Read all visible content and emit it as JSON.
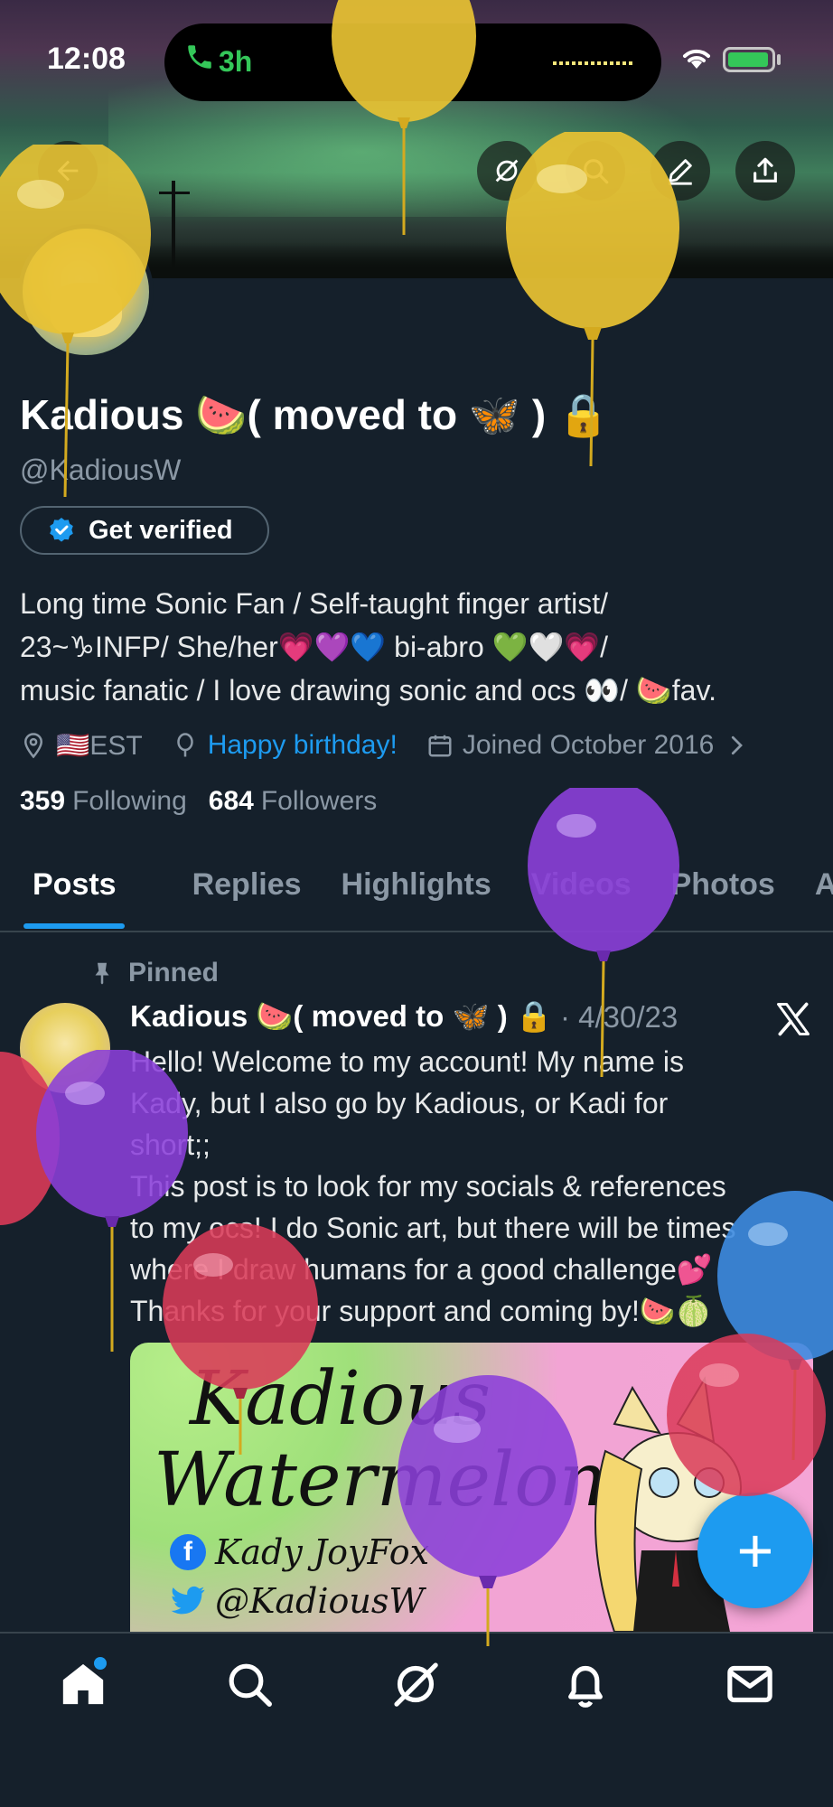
{
  "status_bar": {
    "time": "12:08",
    "call_duration": "3h"
  },
  "banner": {
    "back_icon": "back-arrow-icon",
    "actions": [
      "grok-icon",
      "search-icon",
      "edit-icon",
      "share-icon"
    ]
  },
  "profile": {
    "display_name": "Kadious 🍉( moved to 🦋 ) 🔒",
    "handle": "@KadiousW",
    "verify_label": "Get verified",
    "bio_lines": [
      "Long time Sonic Fan / Self-taught finger artist/",
      "23~♑INFP/ She/her💗💜💙 bi-abro 💚🤍💗/",
      "music fanatic / I love drawing sonic and ocs 👀/ 🍉fav."
    ],
    "location": "🇺🇸EST",
    "birthday": "Happy birthday!",
    "joined": "Joined October 2016",
    "following_count": "359",
    "following_label": "Following",
    "followers_count": "684",
    "followers_label": "Followers"
  },
  "tabs": [
    "Posts",
    "Replies",
    "Highlights",
    "Videos",
    "Photos",
    "Art"
  ],
  "active_tab": "Posts",
  "post": {
    "pinned_label": "Pinned",
    "author": "Kadious 🍉( moved to 🦋 ) 🔒",
    "date": "· 4/30/23",
    "lines": [
      "Hello! Welcome to my account! My name is",
      "Kady, but I also go by Kadious, or Kadi for",
      "short;;",
      "This post is to look for my socials & references",
      "to my ocs! I do Sonic art, but there will be times",
      "where I draw humans for a good challenge💕",
      "Thanks for your support and coming by!🍉🍈"
    ],
    "image": {
      "title_line1": "Kadious",
      "title_line2": "Watermelon",
      "facebook": "Kady JoyFox",
      "twitter": "@KadiousW"
    }
  },
  "fab_label": "+",
  "bottom_nav": [
    "home-icon",
    "search-icon",
    "grok-icon",
    "bell-icon",
    "mail-icon"
  ],
  "colors": {
    "background": "#15202b",
    "accent": "#1d9bf0",
    "muted": "#8b98a5",
    "divider": "#38444d"
  }
}
